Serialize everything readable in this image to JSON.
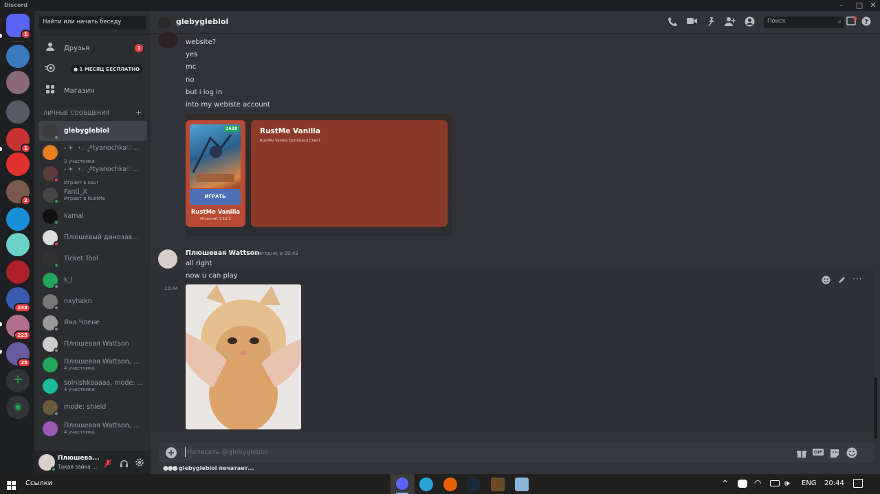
{
  "window": {
    "title": "Discord",
    "controls": [
      "–",
      "□",
      "✕"
    ]
  },
  "servers": [
    {
      "name": "home",
      "icon": "discord-logo-icon",
      "color": "#5865f2",
      "badge": "1"
    },
    {
      "name": "server-2",
      "color": "#3a7bbf",
      "badge": ""
    },
    {
      "name": "server-3",
      "color": "#8a6a7a",
      "badge": ""
    },
    {
      "name": "server-4",
      "color": "#555a66",
      "badge": ""
    },
    {
      "name": "server-5",
      "color": "#c73232",
      "badge": "1"
    },
    {
      "name": "server-6",
      "color": "#e0312f",
      "badge": ""
    },
    {
      "name": "server-7",
      "color": "#7a5a4a",
      "badge": "2"
    },
    {
      "name": "server-8",
      "color": "#1a8fd8",
      "badge": ""
    },
    {
      "name": "server-9",
      "color": "#6ad0c8",
      "badge": ""
    },
    {
      "name": "server-10",
      "color": "#b0202a",
      "badge": ""
    },
    {
      "name": "server-11",
      "color": "#3a5ab0",
      "badge": "238"
    },
    {
      "name": "server-12",
      "color": "#b07090",
      "badge": "225"
    },
    {
      "name": "server-13",
      "color": "#6a5aa0",
      "badge": "25"
    }
  ],
  "dm_search_placeholder": "Найти или начать беседу",
  "nav": {
    "friends": "Друзья",
    "friends_badge": "1",
    "nitro_label": "1 МЕСЯЦ БЕСПЛАТНО",
    "shop": "Магазин"
  },
  "dm_section": "ЛИЧНЫЕ СООБЩЕНИЯ",
  "dms": [
    {
      "name": "glebygleblol",
      "sub": "",
      "color": "#3b3b3b",
      "status": "#80848e",
      "active": true
    },
    {
      "name": "˖ ݁𖥔 ׅ ⋆.ೃ࿔tyanochka♡...",
      "sub": "3 участника",
      "color": "#e67e22",
      "status": "",
      "active": false
    },
    {
      "name": "˖ ݁𖥔 ׅ ⋆.ೃ࿔tyanochka♡...",
      "sub": "Играет в osu!",
      "color": "#5a3a3a",
      "status": "#f23f43",
      "active": false
    },
    {
      "name": "Fanti_X",
      "sub": "Играет в RustMe",
      "color": "#444",
      "status": "#23a55a",
      "active": false
    },
    {
      "name": "kamal",
      "sub": "",
      "color": "#111",
      "status": "#23a55a",
      "active": false
    },
    {
      "name": "Плюшевый динозав...",
      "sub": "",
      "color": "#ddd",
      "status": "#f23f43",
      "active": false
    },
    {
      "name": "Ticket Tool",
      "sub": "",
      "color": "#333",
      "status": "#23a55a",
      "active": false
    },
    {
      "name": "k_l",
      "sub": "",
      "color": "#23a55a",
      "status": "#80848e",
      "active": false
    },
    {
      "name": "nxyhakn",
      "sub": "",
      "color": "#777",
      "status": "#80848e",
      "active": false
    },
    {
      "name": "Яна Члене",
      "sub": "",
      "color": "#999",
      "status": "#80848e",
      "active": false
    },
    {
      "name": "Плюшевая Wattson",
      "sub": "",
      "color": "#ccc",
      "status": "#80848e",
      "active": false
    },
    {
      "name": "Плюшевая Wattson, ...",
      "sub": "4 участника",
      "color": "#23a55a",
      "status": "",
      "active": false
    },
    {
      "name": "solnishkoaaaa, mode: ...",
      "sub": "4 участника",
      "color": "#1abc9c",
      "status": "",
      "active": false
    },
    {
      "name": "mode: shield",
      "sub": "",
      "color": "#6a5a3a",
      "status": "#80848e",
      "active": false
    },
    {
      "name": "Плюшевая Wattson, ...",
      "sub": "4 участника",
      "color": "#9b59b6",
      "status": "",
      "active": false
    }
  ],
  "user": {
    "name": "Плюшева...",
    "status": "Такая зайка ..."
  },
  "channel": {
    "name": "glebygleblol",
    "search_placeholder": "Поиск"
  },
  "messages_top": [
    {
      "text": "website?"
    },
    {
      "text": "yes"
    },
    {
      "text": "mc"
    },
    {
      "text": "no"
    },
    {
      "text": "but i log in"
    },
    {
      "text": "into my webiste account"
    }
  ],
  "embed": {
    "card_badge": "2638",
    "card_button": "ИГРАТЬ",
    "card_title": "RustMe Vanilla",
    "card_sub": "Minecraft 1.12.2",
    "panel_title": "RustMe Vanilla",
    "panel_sub": "RustMe Vanilla Optimized Client"
  },
  "message2": {
    "author": "Плюшевая Wattson",
    "timestamp": "Сегодня, в 20:43",
    "lines": [
      "all right",
      "now u can play"
    ],
    "hover_time": "20:44"
  },
  "composer_placeholder": "Написать @glebygleblol",
  "typing_text": "glebygleblol печатает...",
  "taskbar": {
    "search": "Ссылки",
    "lang": "ENG",
    "time": "20:44"
  },
  "colors": {
    "accent": "#5865f2",
    "danger": "#f23f43",
    "online": "#23a55a",
    "embed": "#8b3a2a"
  }
}
